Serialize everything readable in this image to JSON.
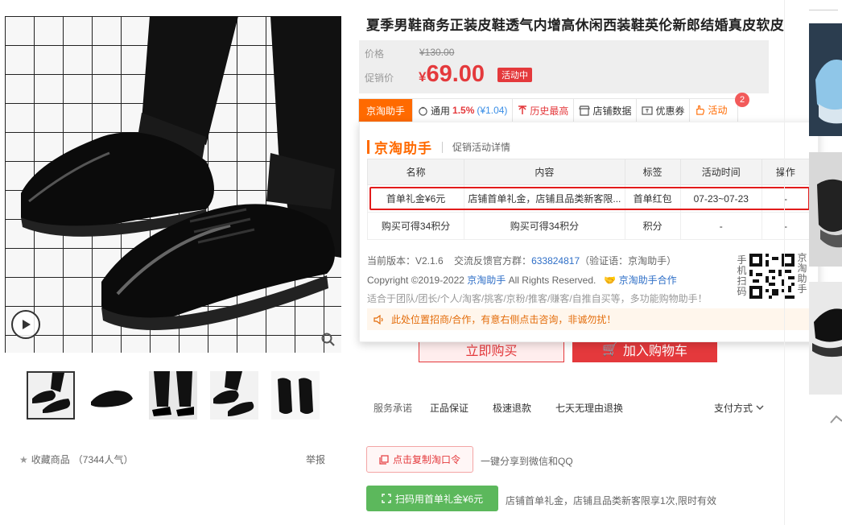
{
  "product": {
    "title": "夏季男鞋商务正装皮鞋透气内增高休闲西装鞋英伦新郎结婚真皮软皮",
    "price_label": "价格",
    "original_price": "¥130.00",
    "promo_label": "促销价",
    "promo_currency": "¥",
    "promo_price": "69.00",
    "promo_badge": "活动中"
  },
  "tabs": [
    {
      "label": "京淘助手"
    },
    {
      "label": "通用",
      "rate": "1.5%",
      "amount": "(¥1.04)"
    },
    {
      "label": "历史最高"
    },
    {
      "label": "店铺数据"
    },
    {
      "label": "优惠券"
    },
    {
      "label": "活动"
    }
  ],
  "tab_badge": "2",
  "popup": {
    "brand": "京淘助手",
    "subtitle": "促销活动详情",
    "headers": [
      "名称",
      "内容",
      "标签",
      "活动时间",
      "操作"
    ],
    "rows": [
      [
        "首单礼金¥6元",
        "店铺首单礼金，店铺且品类新客限...",
        "首单红包",
        "07-23~07-23",
        "-"
      ],
      [
        "购买可得34积分",
        "购买可得34积分",
        "积分",
        "-",
        "-"
      ]
    ],
    "version_text": "当前版本：V2.1.6",
    "feedback_text": "交流反馈官方群：",
    "group_number": "633824817",
    "verify_text": "（验证语：京淘助手）",
    "copyright_prefix": "Copyright ©2019-2022",
    "copyright_link": "京淘助手",
    "copyright_suffix": "All Rights Reserved.",
    "cooperate": "京淘助手合作",
    "audience": "适合于团队/团长/个人/淘客/挑客/京粉/推客/赚客/自推自买等，多功能购物助手！",
    "notice": "此处位置招商/合作，有意右侧点击咨询，非诚勿扰！",
    "qr_left": [
      "手",
      "机",
      "扫",
      "码"
    ],
    "qr_right": [
      "京",
      "淘",
      "助",
      "手"
    ]
  },
  "buy": {
    "buy_now": "立即购买",
    "add_cart": "加入购物车"
  },
  "service": {
    "label": "服务承诺",
    "items": [
      "正品保证",
      "极速退款",
      "七天无理由退换"
    ],
    "pay": "支付方式"
  },
  "share": {
    "copy_button": "点击复制淘口令",
    "copy_desc": "一键分享到微信和QQ",
    "scan_button": "扫码用首单礼金¥6元",
    "scan_desc": "店铺首单礼金，店铺且品类新客限享1次,限时有效"
  },
  "gallery": {
    "favorite": "收藏商品",
    "popularity": "（7344人气）",
    "report": "举报"
  },
  "colors": {
    "accent": "#ff6a00",
    "price_red": "#e4393c",
    "highlight": "#e21b1b",
    "link": "#2f6fc7",
    "scan_green": "#5cb85c"
  }
}
